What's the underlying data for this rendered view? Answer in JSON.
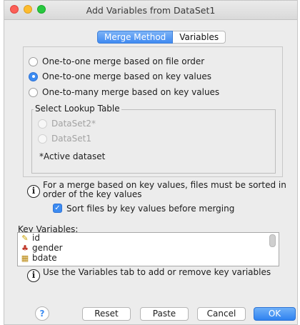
{
  "window": {
    "title": "Add Variables from DataSet1"
  },
  "tabs": [
    "Merge Method",
    "Variables"
  ],
  "merge_options": [
    {
      "label": "One-to-one merge based on file order",
      "selected": false
    },
    {
      "label": "One-to-one merge based on key values",
      "selected": true
    },
    {
      "label": "One-to-many merge based on key values",
      "selected": false
    }
  ],
  "lookup": {
    "title": "Select Lookup Table",
    "options": [
      "DataSet2*",
      "DataSet1"
    ],
    "note": "*Active dataset"
  },
  "info1": {
    "line1": "For a merge based on key values, files must be sorted in",
    "line2": "order of the key values"
  },
  "sort_checkbox": {
    "label": "Sort files by key values before merging",
    "checked": true
  },
  "key_variables": {
    "label": "Key Variables:",
    "items": [
      {
        "name": "id",
        "icon": "scale-variable-icon"
      },
      {
        "name": "gender",
        "icon": "nominal-variable-icon"
      },
      {
        "name": "bdate",
        "icon": "date-variable-icon"
      }
    ]
  },
  "info2": {
    "text": "Use the Variables tab to add or remove key variables"
  },
  "buttons": {
    "help": "?",
    "reset": "Reset",
    "paste": "Paste",
    "cancel": "Cancel",
    "ok": "OK"
  },
  "colors": {
    "accent": "#3c8bf1",
    "window_bg": "#ececec"
  }
}
